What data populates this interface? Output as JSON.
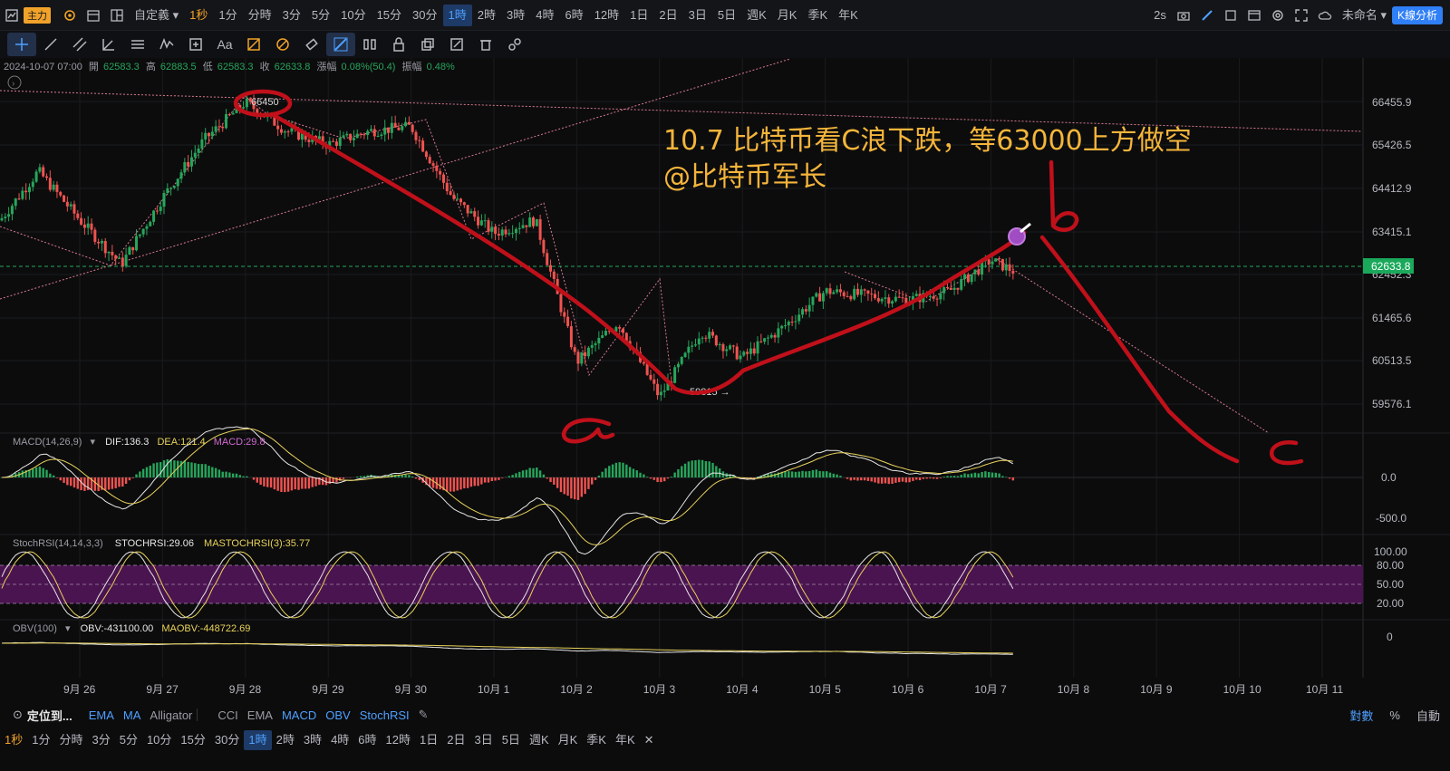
{
  "toolbar": {
    "main_badge": "主力",
    "custom": "自定義",
    "timeframes": [
      "1秒",
      "1分",
      "分時",
      "3分",
      "5分",
      "10分",
      "15分",
      "30分",
      "1時",
      "2時",
      "3時",
      "4時",
      "6時",
      "12時",
      "1日",
      "2日",
      "3日",
      "5日",
      "週K",
      "月K",
      "季K",
      "年K"
    ],
    "active_timeframe": "1時",
    "refresh": "2s",
    "layout_name": "未命名",
    "k_analysis": "K線分析"
  },
  "drawing_tools": {
    "text_tool": "Aa"
  },
  "ohlc": {
    "time": "2024-10-07 07:00",
    "open_label": "開",
    "open": "62583.3",
    "high_label": "高",
    "high": "62883.5",
    "low_label": "低",
    "low": "62583.3",
    "close_label": "收",
    "close": "62633.8",
    "change_label": "漲幅",
    "change": "0.08%(50.4)",
    "amp_label": "振幅",
    "amp": "0.48%"
  },
  "annotation": {
    "line1": "10.7 比特币看C浪下跌，等63000上方做空",
    "line2": "@比特币军长",
    "wave_a": "a",
    "wave_b": "b",
    "wave_c": "c",
    "high_marker": "66450",
    "low_marker": "59815 →"
  },
  "colors": {
    "up": "#26a65b",
    "down": "#ef5350",
    "annotation_text": "#f5b53a",
    "handwriting": "#c0101a",
    "price_tag": "#1aa85a",
    "stoch_band": "#4a1450"
  },
  "chart_data": [
    {
      "type": "candlestick",
      "x_tick_labels": [
        "9月 26",
        "9月 27",
        "9月 28",
        "9月 29",
        "9月 30",
        "10月 1",
        "10月 2",
        "10月 3",
        "10月 4",
        "10月 5",
        "10月 6",
        "10月 7",
        "10月 8",
        "10月 9",
        "10月 10",
        "10月 11"
      ],
      "y_tick_labels": [
        "66455.9",
        "65426.5",
        "64412.9",
        "63415.1",
        "62452.3",
        "61465.6",
        "60513.5",
        "59576.1"
      ],
      "ylim": [
        59000,
        67000
      ],
      "current_price_label": "62633.8",
      "current_price": 62633.8,
      "marked_high": 66450,
      "marked_low": 59815,
      "path_points": [
        [
          "9月 25",
          63700
        ],
        [
          "9月 25 12:00",
          64900
        ],
        [
          "9月 26",
          63800
        ],
        [
          "9月 26 12:00",
          62800
        ],
        [
          "9月 27",
          64300
        ],
        [
          "9月 27 12:00",
          65600
        ],
        [
          "9月 28",
          66450
        ],
        [
          "9月 28 12:00",
          65800
        ],
        [
          "9月 29",
          65500
        ],
        [
          "9月 29 12:00",
          65800
        ],
        [
          "9月 30",
          65900
        ],
        [
          "9月 30 12:00",
          64300
        ],
        [
          "10月 1",
          63500
        ],
        [
          "10月 1 12:00",
          63800
        ],
        [
          "10月 2",
          60600
        ],
        [
          "10月 2 12:00",
          61500
        ],
        [
          "10月 3",
          59815
        ],
        [
          "10月 3 12:00",
          61300
        ],
        [
          "10月 4",
          60700
        ],
        [
          "10月 4 12:00",
          61400
        ],
        [
          "10月 5",
          62200
        ],
        [
          "10月 5 12:00",
          62100
        ],
        [
          "10月 6",
          62000
        ],
        [
          "10月 6 12:00",
          62200
        ],
        [
          "10月 7",
          62900
        ],
        [
          "10月 7 07:00",
          62633.8
        ]
      ]
    },
    {
      "type": "bar",
      "name_label": "MACD(14,26,9)",
      "dif_label": "DIF:136.3",
      "dea_label": "DEA:121.4",
      "macd_label": "MACD:29.8",
      "y_tick_labels": [
        "0.0",
        "-500.0"
      ]
    },
    {
      "type": "line",
      "name_label": "StochRSI(14,14,3,3)",
      "stoch_label": "STOCHRSI:29.06",
      "ma_label": "MASTOCHRSI(3):35.77",
      "y_tick_labels": [
        "100.00",
        "80.00",
        "50.00",
        "20.00"
      ]
    },
    {
      "type": "line",
      "name_label": "OBV(100)",
      "obv_label": "OBV:-431100.00",
      "maobv_label": "MAOBV:-448722.69",
      "y_tick_labels": [
        "0"
      ]
    }
  ],
  "indicator_bar": {
    "locate": "定位到...",
    "main": [
      "EMA",
      "MA",
      "Alligator"
    ],
    "sub": [
      "CCI",
      "EMA",
      "MACD",
      "OBV",
      "StochRSI"
    ],
    "active": [
      "EMA",
      "MA",
      "MACD",
      "OBV",
      "StochRSI"
    ],
    "log": "對數",
    "percent": "%",
    "auto": "自動"
  },
  "bottom_timeframes": [
    "1秒",
    "1分",
    "分時",
    "3分",
    "5分",
    "10分",
    "15分",
    "30分",
    "1時",
    "2時",
    "3時",
    "4時",
    "6時",
    "12時",
    "1日",
    "2日",
    "3日",
    "5日",
    "週K",
    "月K",
    "季K",
    "年K"
  ]
}
